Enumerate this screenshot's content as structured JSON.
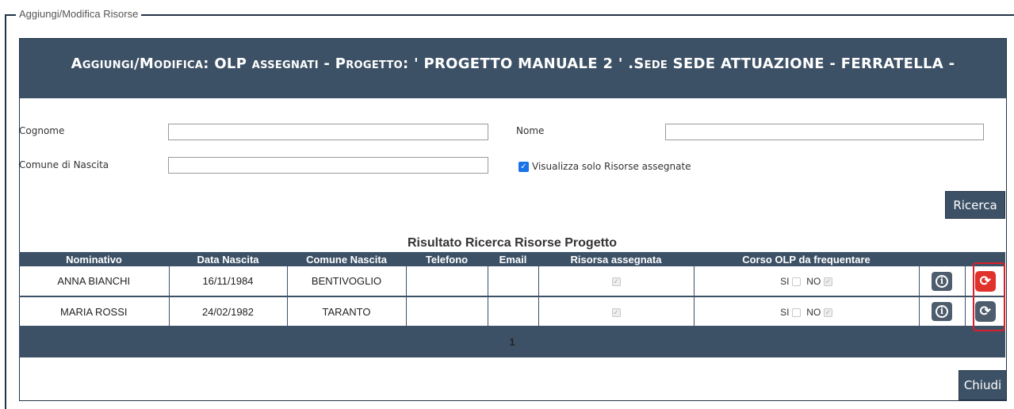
{
  "fieldset": {
    "legend": "Aggiungi/Modifica Risorse"
  },
  "header": {
    "part1": "Aggiungi/Modifica:",
    "part2": " OLP ",
    "part3": "assegnati - Progetto:",
    "part4": " ' PROGETTO MANUALE 2 ' .",
    "part5": "Sede",
    "part6": " SEDE ATTUAZIONE - FERRATELLA -"
  },
  "form": {
    "cognome_label": "Cognome",
    "cognome_value": "",
    "nome_label": "Nome",
    "nome_value": "",
    "comune_label": "Comune di Nascita",
    "comune_value": "",
    "checkbox_label": "Visualizza solo Risorse assegnate",
    "checkbox_checked": true,
    "search_button": "Ricerca"
  },
  "results": {
    "title": "Risultato Ricerca Risorse Progetto",
    "columns": [
      "Nominativo",
      "Data Nascita",
      "Comune Nascita",
      "Telefono",
      "Email",
      "Risorsa assegnata",
      "Corso OLP da frequentare",
      "",
      ""
    ],
    "rows": [
      {
        "nominativo": "ANNA BIANCHI",
        "data_nascita": "16/11/1984",
        "comune_nascita": "BENTIVOGLIO",
        "telefono": "",
        "email": "",
        "risorsa_assegnata": true,
        "si": false,
        "no": true,
        "si_label": "SI",
        "no_label": "NO",
        "action_icon": "swap-icon-red"
      },
      {
        "nominativo": "MARIA ROSSI",
        "data_nascita": "24/02/1982",
        "comune_nascita": "TARANTO",
        "telefono": "",
        "email": "",
        "risorsa_assegnata": true,
        "si": false,
        "no": true,
        "si_label": "SI",
        "no_label": "NO",
        "action_icon": "swap-icon-gray"
      }
    ],
    "page": "1"
  },
  "close_button": "Chiudi",
  "colors": {
    "header_bg": "#3d5166",
    "highlight": "#d9212b",
    "swap_active": "#e0312a"
  }
}
